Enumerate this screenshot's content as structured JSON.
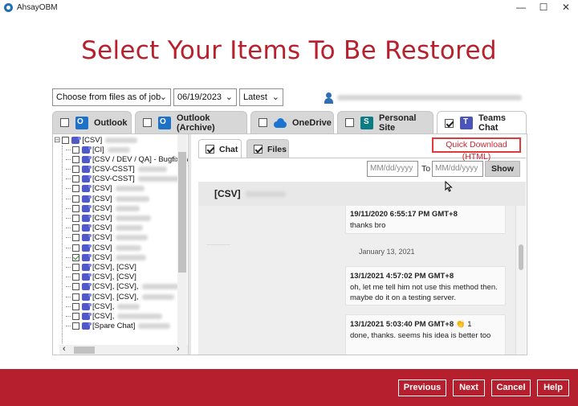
{
  "window": {
    "title": "AhsayOBM",
    "minimize": "—",
    "maximize": "☐",
    "close": "✕"
  },
  "heading": "Select Your Items To Be Restored",
  "filters": {
    "source": "Choose from files as of job",
    "date": "06/19/2023",
    "version": "Latest",
    "chevron": "⌄"
  },
  "tabs": [
    {
      "label": "Outlook",
      "checked": false,
      "icon": "outlook-icon"
    },
    {
      "label": "Outlook (Archive)",
      "checked": false,
      "icon": "outlook-archive-icon"
    },
    {
      "label": "OneDrive",
      "checked": false,
      "icon": "onedrive-icon"
    },
    {
      "label": "Personal Site",
      "checked": false,
      "icon": "sharepoint-icon"
    },
    {
      "label": "Teams Chat",
      "checked": true,
      "icon": "teams-icon"
    }
  ],
  "tree": {
    "root": "[CSV]",
    "expander": "⊟",
    "items": [
      {
        "label": "[CI]",
        "checked": false
      },
      {
        "label": "[CSV / DEV / QA] - Bugfix We",
        "checked": false
      },
      {
        "label": "[CSV-CSST]",
        "checked": false
      },
      {
        "label": "[CSV-CSST]",
        "checked": false
      },
      {
        "label": "[CSV]",
        "checked": false
      },
      {
        "label": "[CSV]",
        "checked": false
      },
      {
        "label": "[CSV]",
        "checked": false
      },
      {
        "label": "[CSV]",
        "checked": false
      },
      {
        "label": "[CSV]",
        "checked": false
      },
      {
        "label": "[CSV]",
        "checked": false
      },
      {
        "label": "[CSV]",
        "checked": false
      },
      {
        "label": "[CSV]",
        "checked": true
      },
      {
        "label": "[CSV], [CSV]",
        "checked": false
      },
      {
        "label": "[CSV], [CSV]",
        "checked": false
      },
      {
        "label": "[CSV], [CSV],",
        "checked": false
      },
      {
        "label": "[CSV], [CSV],",
        "checked": false
      },
      {
        "label": "[CSV],",
        "checked": false
      },
      {
        "label": "[CSV],",
        "checked": false
      },
      {
        "label": "[Spare Chat]",
        "checked": false
      }
    ],
    "scroll_left": "‹",
    "scroll_right": "›"
  },
  "subtabs": [
    {
      "label": "Chat",
      "checked": true
    },
    {
      "label": "Files",
      "checked": true
    }
  ],
  "quick_download": "Quick Download (HTML)",
  "date_range": {
    "from_placeholder": "MM/dd/yyyy",
    "to_label": "To",
    "to_placeholder": "MM/dd/yyyy",
    "show": "Show"
  },
  "chat": {
    "title": "[CSV]",
    "messages": [
      {
        "meta": "19/11/2020 6:55:17 PM GMT+8",
        "lines": [
          "thanks bro"
        ]
      },
      {
        "meta": "13/1/2021 4:57:02 PM GMT+8",
        "lines": [
          "oh, let me tell him not use this method then.",
          "maybe do it on a testing server."
        ]
      },
      {
        "meta": "13/1/2021 5:03:40 PM GMT+8",
        "reaction": "👏",
        "reaction_count": "1",
        "lines": [
          "done, thanks. seems his idea is better too"
        ]
      }
    ],
    "day_separator": "January 13, 2021"
  },
  "footer": {
    "previous": "Previous",
    "next": "Next",
    "cancel": "Cancel",
    "help": "Help"
  },
  "colors": {
    "brand_red": "#b61f2d",
    "heading_red": "#b8202d",
    "teams_purple": "#4b53bc"
  }
}
